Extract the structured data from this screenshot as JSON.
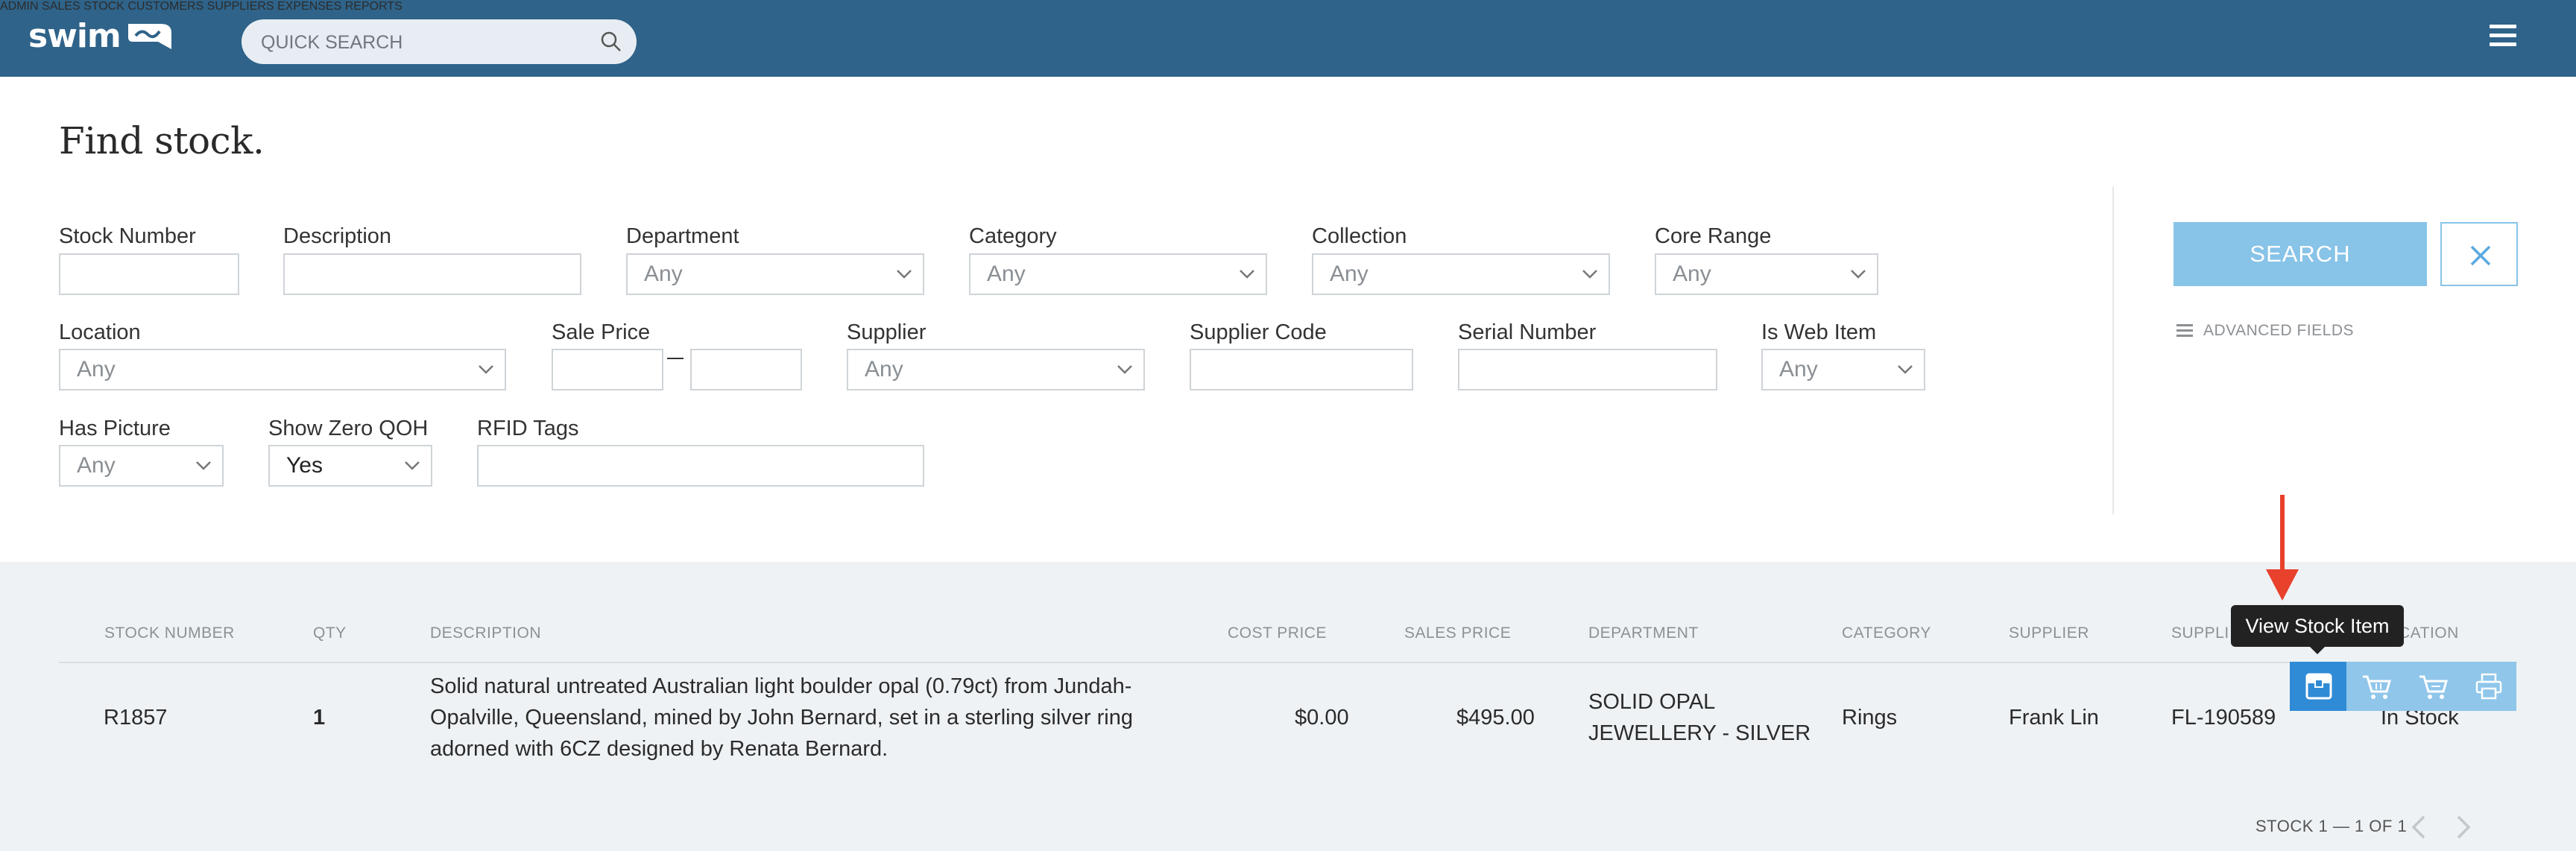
{
  "header": {
    "logo_text": "swim",
    "search_placeholder": "QUICK SEARCH",
    "nav": [
      "ADMIN",
      "SALES",
      "STOCK",
      "CUSTOMERS",
      "SUPPLIERS",
      "EXPENSES",
      "REPORTS"
    ],
    "brand_color": "#2f6389"
  },
  "page": {
    "title": "Find stock."
  },
  "filters": {
    "stock_number": {
      "label": "Stock Number",
      "value": ""
    },
    "description": {
      "label": "Description",
      "value": ""
    },
    "department": {
      "label": "Department",
      "value": "Any"
    },
    "category": {
      "label": "Category",
      "value": "Any"
    },
    "collection": {
      "label": "Collection",
      "value": "Any"
    },
    "core_range": {
      "label": "Core Range",
      "value": "Any"
    },
    "location": {
      "label": "Location",
      "value": "Any"
    },
    "sale_price": {
      "label": "Sale Price",
      "min": "",
      "max": ""
    },
    "supplier": {
      "label": "Supplier",
      "value": "Any"
    },
    "supplier_code": {
      "label": "Supplier Code",
      "value": ""
    },
    "serial_number": {
      "label": "Serial Number",
      "value": ""
    },
    "is_web_item": {
      "label": "Is Web Item",
      "value": "Any"
    },
    "has_picture": {
      "label": "Has Picture",
      "value": "Any"
    },
    "show_zero_qoh": {
      "label": "Show Zero QOH",
      "value": "Yes"
    },
    "rfid_tags": {
      "label": "RFID Tags",
      "value": ""
    }
  },
  "actions": {
    "search_label": "SEARCH",
    "advanced_label": "ADVANCED FIELDS",
    "accent": "#88c3e8"
  },
  "table": {
    "columns": [
      "STOCK NUMBER",
      "QTY",
      "DESCRIPTION",
      "COST PRICE",
      "SALES PRICE",
      "DEPARTMENT",
      "CATEGORY",
      "SUPPLIER",
      "SUPPLI",
      "CATION"
    ],
    "rows": [
      {
        "stock_number": "R1857",
        "qty": "1",
        "description_lines": [
          "Solid natural untreated Australian light boulder opal (0.79ct) from Jundah-",
          "Opalville, Queensland, mined by John Bernard, set in a sterling silver ring",
          "adorned with 6CZ designed by Renata Bernard."
        ],
        "cost_price": "$0.00",
        "sales_price": "$495.00",
        "department_lines": [
          "SOLID OPAL",
          "JEWELLERY - SILVER"
        ],
        "category": "Rings",
        "supplier": "Frank Lin",
        "supplier_code": "FL-190589",
        "location": "In Stock"
      }
    ],
    "row_action_icons": [
      "view-stock-item-icon",
      "cart-icon",
      "cart-add-icon",
      "print-icon"
    ],
    "tooltip": "View Stock Item"
  },
  "pagination": {
    "text": "STOCK 1 — 1 OF 1"
  }
}
